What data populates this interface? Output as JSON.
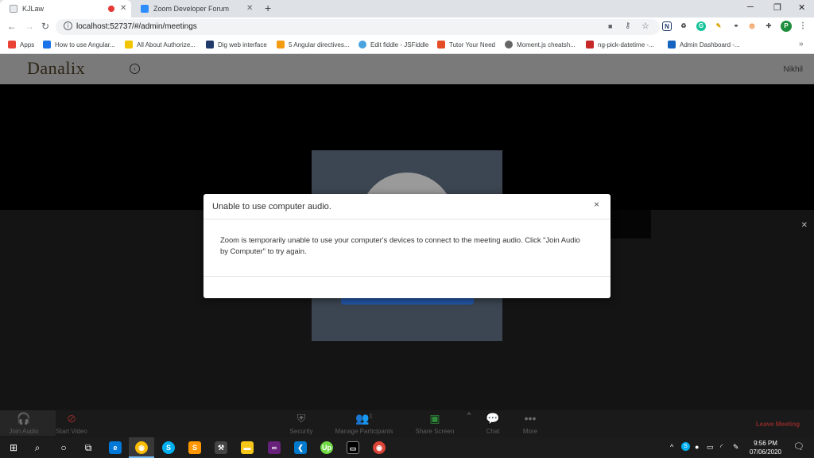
{
  "browser": {
    "tabs": [
      {
        "title": "KJLaw",
        "active": true
      },
      {
        "title": "Zoom Developer Forum",
        "active": false
      }
    ],
    "url": "localhost:52737/#/admin/meetings",
    "bookmarks": [
      {
        "label": "Apps",
        "icon": "apps-grid-icon",
        "color": "#ea4335"
      },
      {
        "label": "How to use Angular...",
        "icon": "video-icon",
        "color": "#1a73e8"
      },
      {
        "label": "All About Authorize...",
        "icon": "checker-flag-icon",
        "color": "#f2c500"
      },
      {
        "label": "Dig web interface",
        "icon": "dig-icon",
        "color": "#1f3a6b"
      },
      {
        "label": "5 Angular directives...",
        "icon": "bookmark-icon",
        "color": "#f39c12"
      },
      {
        "label": "Edit fiddle - JSFiddle",
        "icon": "cloud-icon",
        "color": "#4aa3df"
      },
      {
        "label": "Tutor Your Need",
        "icon": "grid-icon",
        "color": "#e44d26"
      },
      {
        "label": "Moment.js cheatsh...",
        "icon": "globe-icon",
        "color": "#666666"
      },
      {
        "label": "ng-pick-datetime -...",
        "icon": "square-icon",
        "color": "#c62828"
      },
      {
        "label": "Admin Dashboard -...",
        "icon": "x-logo-icon",
        "color": "#1565c0"
      }
    ]
  },
  "app": {
    "logo": "Danalix",
    "user": "Nikhil"
  },
  "modal": {
    "title": "Unable to use computer audio.",
    "body": "Zoom is temporarily unable to use your computer's devices to connect to the meeting audio. Click \"Join Audio by Computer\" to try again."
  },
  "controls": {
    "join_audio": "Join Audio",
    "start_video": "Start Video",
    "security": "Security",
    "participants_count": "1",
    "manage_participants": "Manage Participants",
    "share_screen": "Share Screen",
    "chat": "Chat",
    "more": "More",
    "leave": "Leave Meeting"
  },
  "taskbar": {
    "time": "9:56 PM",
    "date": "07/06/2020"
  },
  "colors": {
    "accent": "#2357a8",
    "leave": "#8e2a2a",
    "share_green": "#2e8b3a"
  }
}
